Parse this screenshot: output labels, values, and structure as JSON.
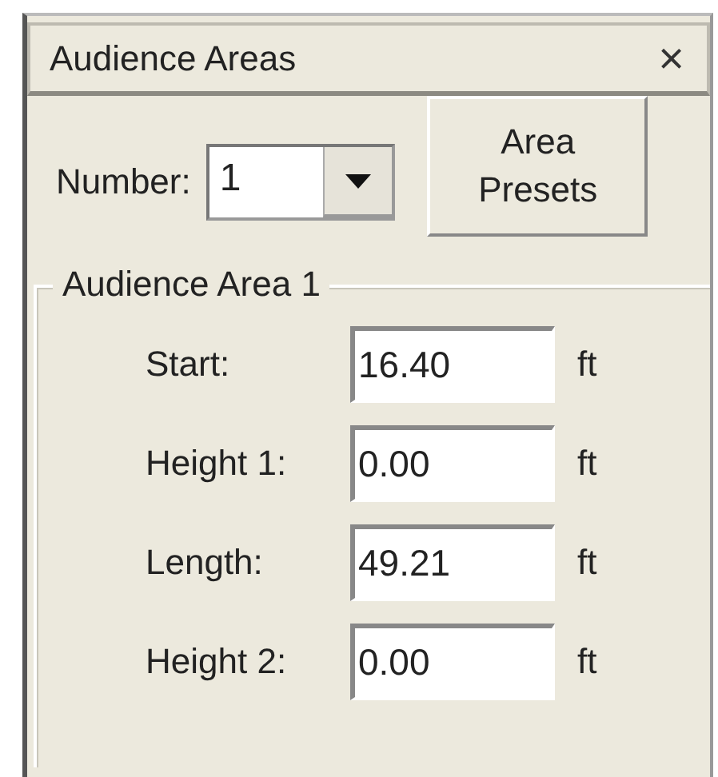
{
  "window": {
    "title": "Audience Areas",
    "close": "×"
  },
  "number": {
    "label": "Number:",
    "value": "1"
  },
  "presets_button": {
    "label": "Area Presets"
  },
  "group": {
    "title": "Audience Area 1",
    "fields": [
      {
        "label": "Start:",
        "value": "16.40",
        "unit": "ft"
      },
      {
        "label": "Height 1:",
        "value": "0.00",
        "unit": "ft"
      },
      {
        "label": "Length:",
        "value": "49.21",
        "unit": "ft"
      },
      {
        "label": "Height 2:",
        "value": "0.00",
        "unit": "ft"
      }
    ]
  }
}
